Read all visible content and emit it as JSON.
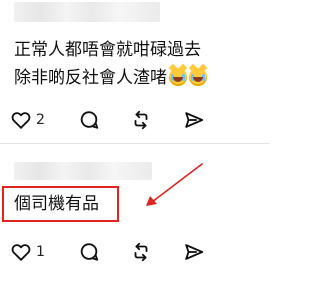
{
  "posts": [
    {
      "lines": [
        "正常人都唔會就咁碌過去",
        "除非啲反社會人渣啫"
      ],
      "emojis": [
        "grinning-cat-tears-icon",
        "grinning-cat-tears-icon"
      ],
      "likes": "2",
      "actions": [
        "heart-icon",
        "comment-icon",
        "repost-icon",
        "share-icon"
      ]
    },
    {
      "text": "個司機有品",
      "likes": "1",
      "actions": [
        "heart-icon",
        "comment-icon",
        "repost-icon",
        "share-icon"
      ]
    }
  ],
  "annotation": {
    "box_color": "#e0231e",
    "arrow_color": "#e0231e"
  }
}
